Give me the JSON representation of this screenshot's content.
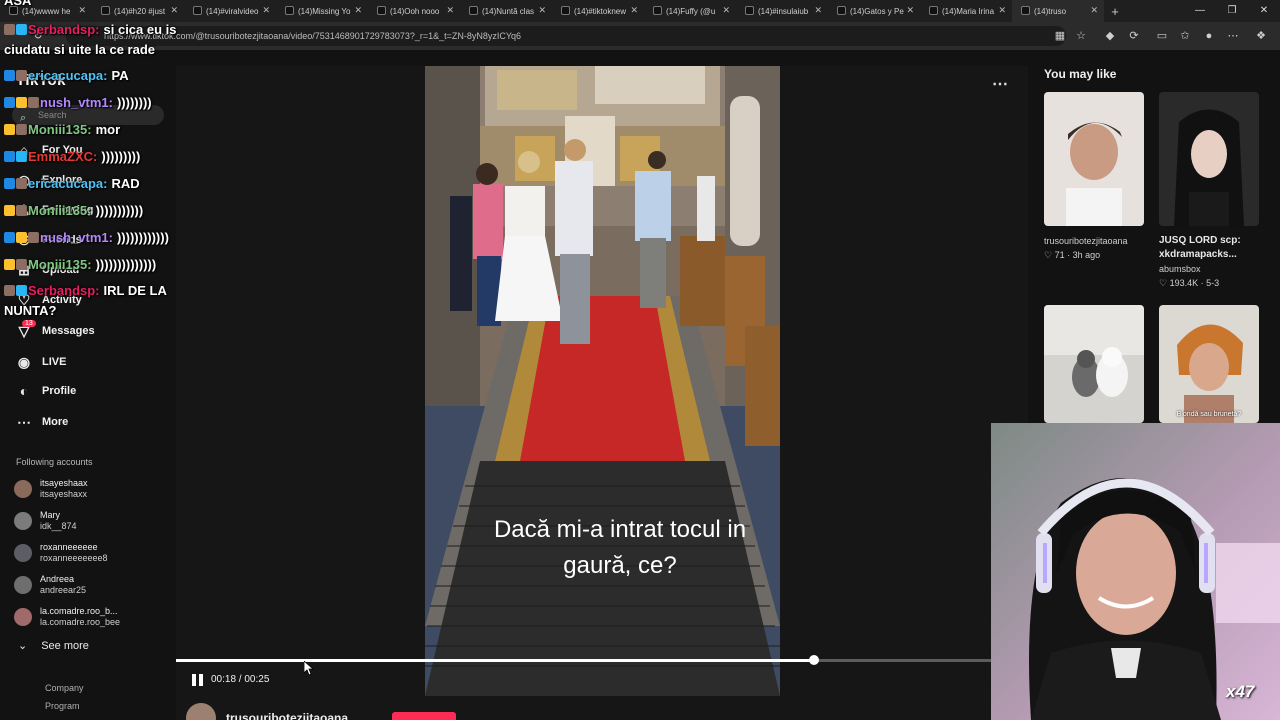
{
  "browser": {
    "tabs": [
      {
        "label": "(14)wwww he"
      },
      {
        "label": "(14)#h20 #just"
      },
      {
        "label": "(14)#viralvideo"
      },
      {
        "label": "(14)Missing Yo"
      },
      {
        "label": "(14)Ooh nooo"
      },
      {
        "label": "(14)Nuntă clas"
      },
      {
        "label": "(14)#tiktoknew"
      },
      {
        "label": "(14)Fuffy (@u"
      },
      {
        "label": "(14)#insulaiub"
      },
      {
        "label": "(14)Gatos y Pe"
      },
      {
        "label": "(14)Maria Irina"
      },
      {
        "label": "(14)truso"
      }
    ],
    "url": "https://www.tiktok.com/@trusouribotezjitaoana/video/7531468901729783073?_r=1&_t=ZN-8yN8yzICYq6"
  },
  "sidebar": {
    "logo": "TikTok",
    "search_placeholder": "Search",
    "nav": [
      {
        "label": "For You",
        "icon": "home-icon"
      },
      {
        "label": "Explore",
        "icon": "compass-icon"
      },
      {
        "label": "Following",
        "icon": "following-icon"
      },
      {
        "label": "Friends",
        "icon": "friends-icon"
      },
      {
        "label": "Upload",
        "icon": "upload-icon"
      },
      {
        "label": "Activity",
        "icon": "activity-icon"
      },
      {
        "label": "Messages",
        "icon": "messages-icon"
      },
      {
        "label": "LIVE",
        "icon": "live-icon"
      },
      {
        "label": "Profile",
        "icon": "profile-icon"
      },
      {
        "label": "More",
        "icon": "more-icon"
      }
    ],
    "messages_badge": "13",
    "following_title": "Following accounts",
    "accounts": [
      {
        "name": "itsayeshaax",
        "handle": "itsayeshaxx"
      },
      {
        "name": "Mary",
        "handle": "idk__874"
      },
      {
        "name": "roxanneeeeee",
        "handle": "roxanneeeeeee8"
      },
      {
        "name": "Andreea",
        "handle": "andreear25"
      },
      {
        "name": "la.comadre.roo_b...",
        "handle": "la.comadre.roo_bee"
      }
    ],
    "see_more": "See more",
    "footer": [
      "Company",
      "Program"
    ]
  },
  "chat": [
    {
      "user": "Serbandsp:",
      "text": "si cica eu is",
      "user_color": "#e91e63"
    },
    {
      "user": "",
      "text": "ciudatu si uite la ce rade",
      "user_color": "#ffffff"
    },
    {
      "user": "ericacucapa:",
      "text": "PA",
      "user_color": "#4fc3f7"
    },
    {
      "user": "nush_vtm1:",
      "text": "))))))))",
      "user_color": "#b388ff"
    },
    {
      "user": "Moniii135:",
      "text": "mor",
      "user_color": "#81c784"
    },
    {
      "user": "EmmaZXC:",
      "text": ")))))))))",
      "user_color": "#e53935"
    },
    {
      "user": "ericacucapa:",
      "text": "RAD",
      "user_color": "#4fc3f7"
    },
    {
      "user": "Moniii135:",
      "text": ")))))))))))",
      "user_color": "#81c784"
    },
    {
      "user": "nush_vtm1:",
      "text": "))))))))))))",
      "user_color": "#b388ff"
    },
    {
      "user": "Moniii135:",
      "text": "))))))))))))))",
      "user_color": "#81c784"
    },
    {
      "user": "Serbandsp:",
      "text": "IRL DE LA",
      "user_color": "#e91e63"
    },
    {
      "user": "",
      "text": "NUNTA?",
      "user_color": "#ffffff"
    }
  ],
  "chat_header_fragment": "ASA",
  "video": {
    "caption_line1": "Dacă mi-a intrat tocul in",
    "caption_line2": "gaură, ce?",
    "time": "00:18 / 00:25",
    "progress": 0.783,
    "author": "trusouribotezjitaoana"
  },
  "right": {
    "title": "You may like",
    "cards": [
      {
        "title": "",
        "user": "trusouribotezjitaoana",
        "meta": "♡ 71 · 3h ago"
      },
      {
        "title": "JUSQ LORD scp: xkdramapacks...",
        "user": "abumsbox",
        "meta": "♡ 193.4K · 5-3"
      },
      {
        "title": "",
        "user": "",
        "meta": ""
      },
      {
        "title": "Blondă sau brunetă?",
        "user": "",
        "meta": ""
      }
    ]
  },
  "webcam_badge": "x47",
  "colors": {
    "accent": "#fe2c55",
    "background": "#121212",
    "carpet": "#c62828"
  }
}
